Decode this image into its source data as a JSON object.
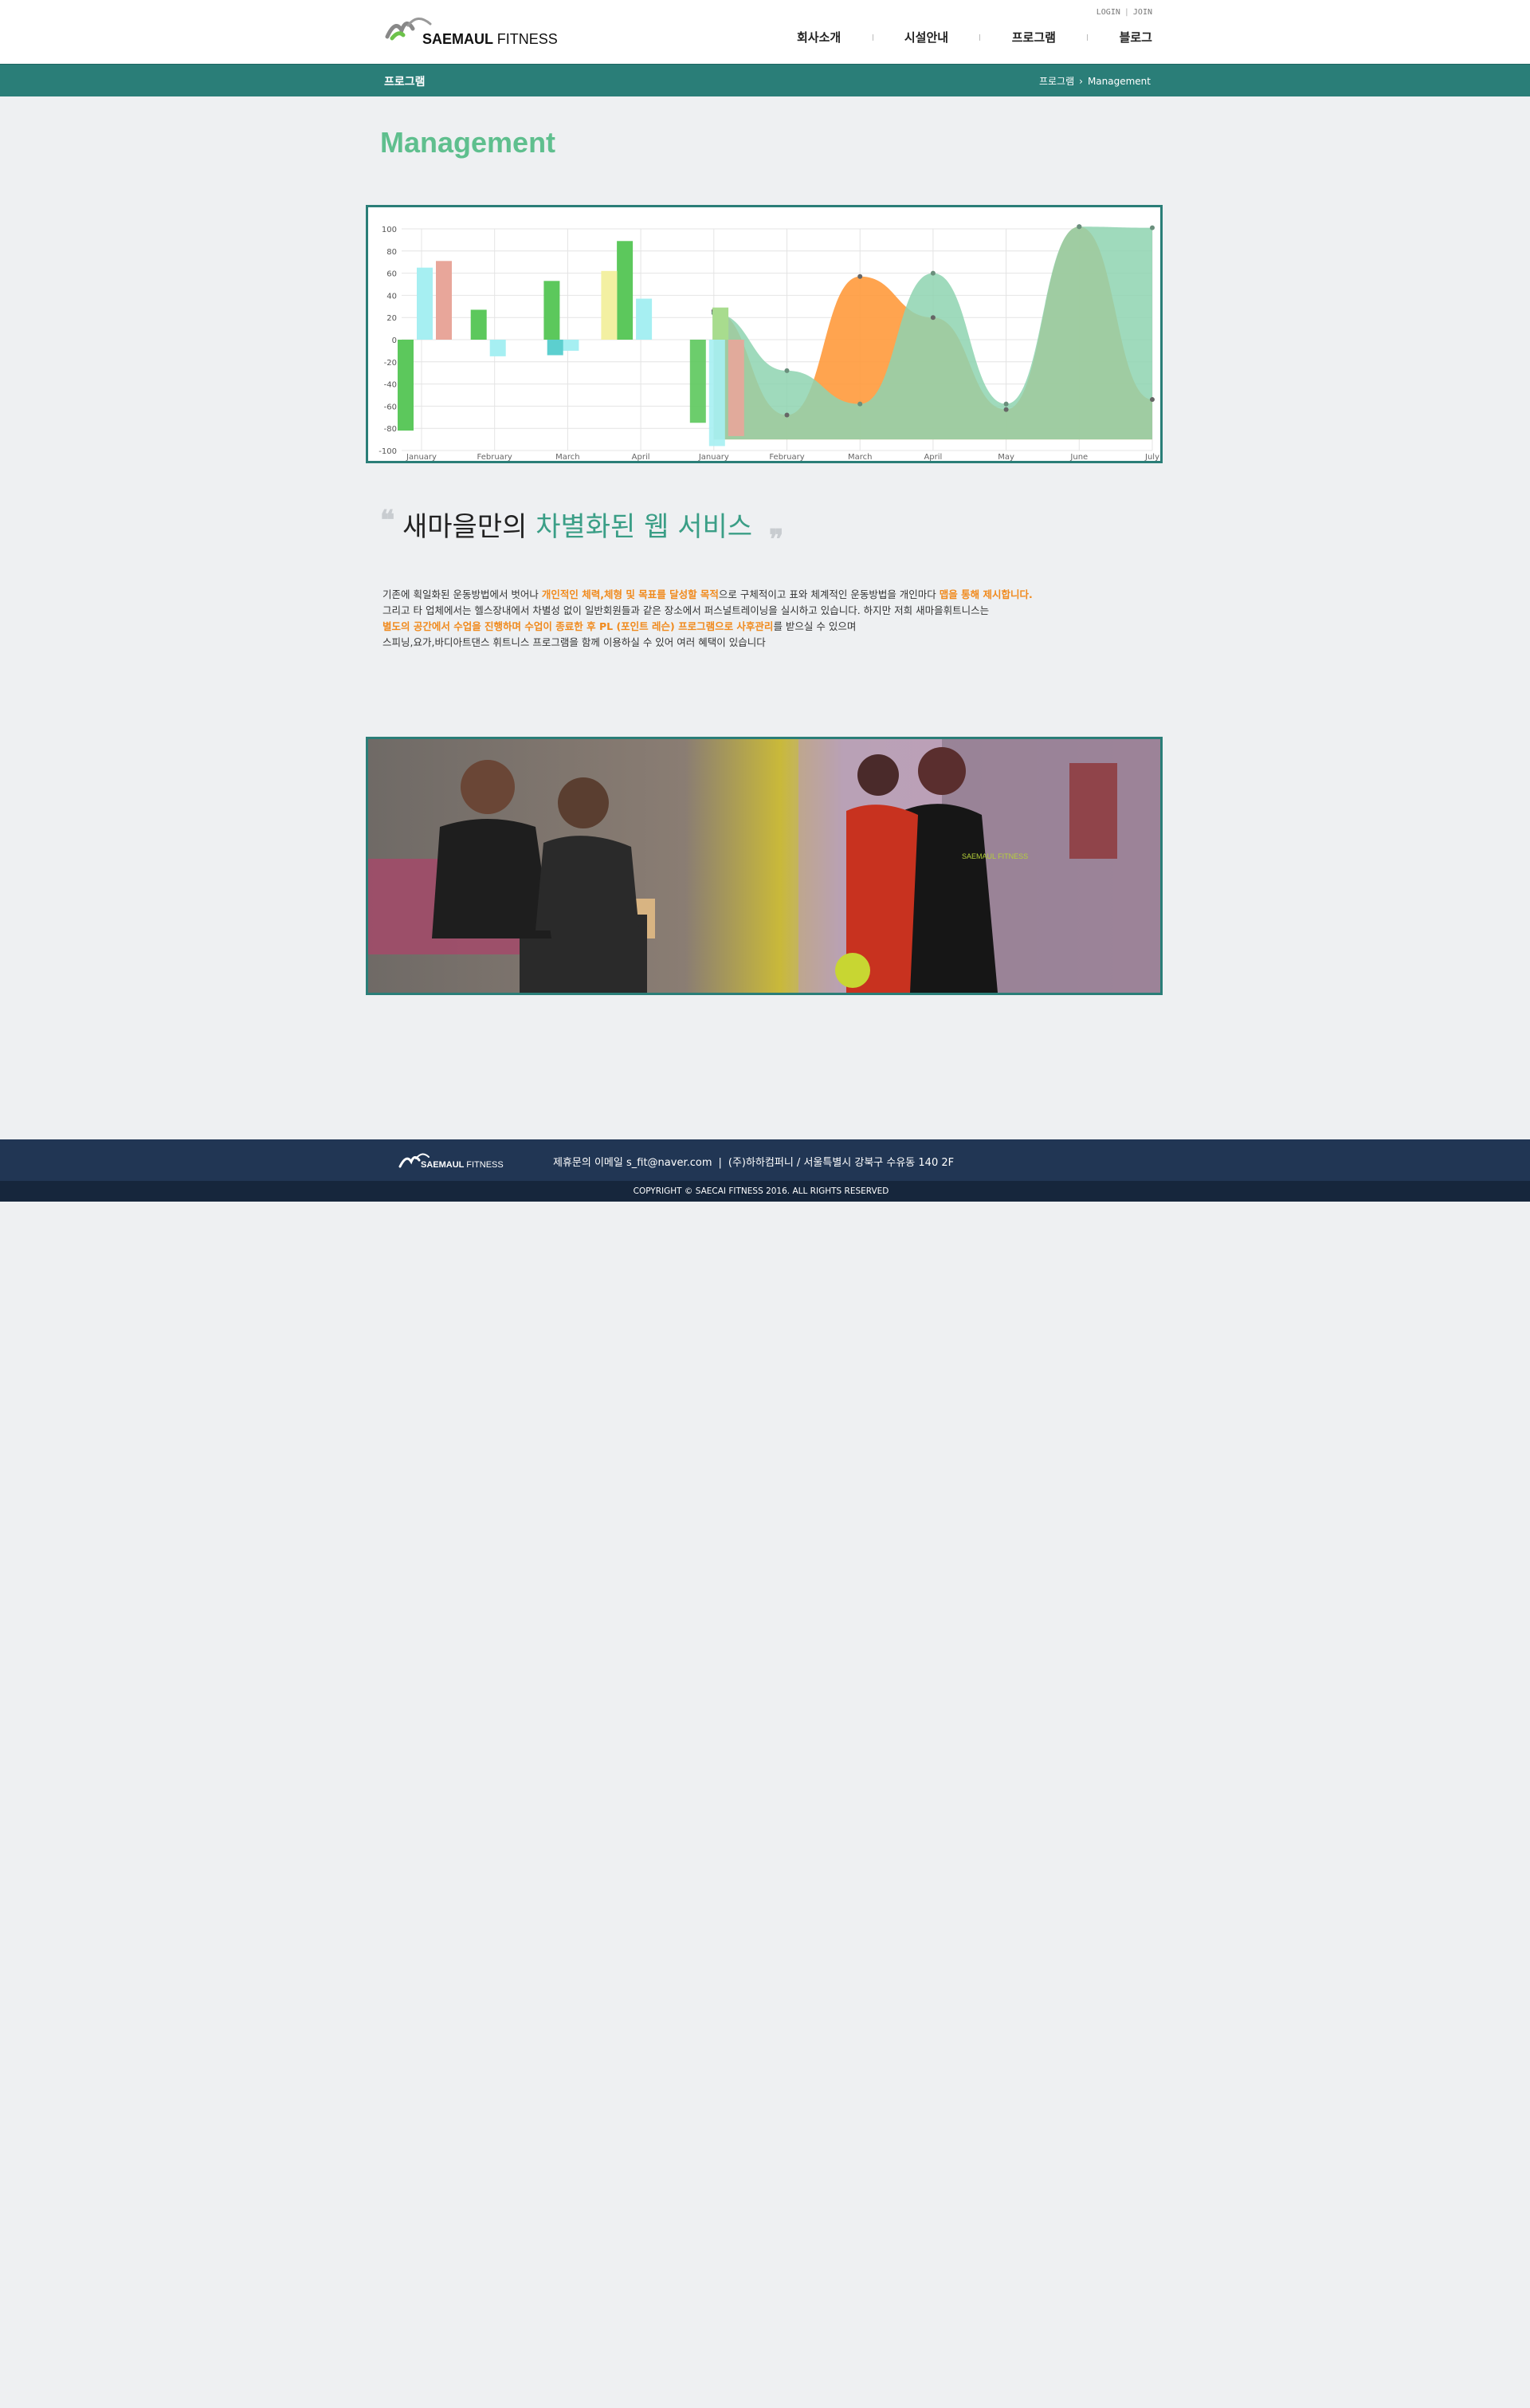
{
  "header": {
    "logo_text": "SAEMAUL",
    "logo_suffix": "FITNESS",
    "util": [
      "LOGIN",
      "JOIN"
    ],
    "nav": [
      "회사소개",
      "시설안내",
      "프로그램",
      "블로그"
    ]
  },
  "subbar": {
    "title": "프로그램",
    "breadcrumb": [
      "프로그램",
      "Management"
    ]
  },
  "page_title": "Management",
  "chart_data": {
    "type": "bar",
    "categories": [
      "January",
      "February",
      "March",
      "April",
      "January",
      "February",
      "March",
      "April",
      "May",
      "June",
      "July"
    ],
    "ylim": [
      -100,
      100
    ],
    "yticks": [
      100,
      80,
      60,
      40,
      20,
      0,
      -20,
      -40,
      -60,
      -80,
      -100
    ],
    "series": [
      {
        "color": "#5cc85c",
        "values": [
          -82,
          27,
          53,
          89,
          -75
        ]
      },
      {
        "color": "#a6eff2",
        "values": [
          65,
          -15,
          -10,
          37,
          -96
        ]
      },
      {
        "color": "#e8a69a",
        "values": [
          71,
          null,
          null,
          null,
          -87
        ]
      },
      {
        "color": "#f3f0a2",
        "values": [
          null,
          null,
          62,
          null,
          null
        ]
      },
      {
        "color": "#5ccfcf",
        "values": [
          null,
          -14,
          null,
          null,
          null
        ]
      },
      {
        "color": "#a8dc8e",
        "values": [
          null,
          null,
          null,
          29,
          null
        ]
      }
    ],
    "area_orange": [
      null,
      null,
      null,
      null,
      26,
      -68,
      57,
      20,
      -63,
      102,
      -54
    ],
    "area_green": [
      null,
      null,
      null,
      null,
      24,
      -28,
      -58,
      60,
      -58,
      102,
      101
    ],
    "colors": {
      "area_orange": "#ff9a3c",
      "area_green": "#8ed3b0",
      "grid": "#e4e4e4"
    }
  },
  "headline": {
    "quote_open": "❝",
    "dark": "새마을만의",
    "accent": "차별화된 웹 서비스",
    "quote_close": "❞"
  },
  "description": {
    "line1_a": "기존에 획일화된 운동방법에서 벗어나 ",
    "line1_hl1": "개인적인 체력,체형 및 목표를 달성할 목적",
    "line1_b": "으로 구체적이고 표와 체계적인 운동방법을 개인마다 ",
    "line1_hl2": "맵을 통해 제시합니다.",
    "line2": "그리고 타 업체에서는 헬스장내에서 차별성 없이 일반회원들과 같은 장소에서 퍼스널트레이닝을 실시하고 있습니다. 하지만 저희 새마을휘트니스는",
    "line3_hl": "별도의 공간에서 수업을 진행하며 수업이 종료한 후 PL (포인트 레슨) 프로그램으로 사후관리",
    "line3_b": "를 받으실 수 있으며",
    "line4": "스피닝,요가,바디아트댄스 휘트니스 프로그램을 함께 이용하실 수 있어 여러 혜택이 있습니다"
  },
  "photo": {
    "shirt_text": "SAEMAUL FITNESS"
  },
  "footer": {
    "logo_text": "SAEMAUL",
    "logo_suffix": "FITNESS",
    "email": "제휴문의 이메일 s_fit@naver.com",
    "sep": "|",
    "company": "(주)하하컴퍼니 / 서울특별시 강북구 수유동 140 2F",
    "copyright": "COPYRIGHT © SAECAI FITNESS 2016. ALL RIGHTS RESERVED"
  }
}
